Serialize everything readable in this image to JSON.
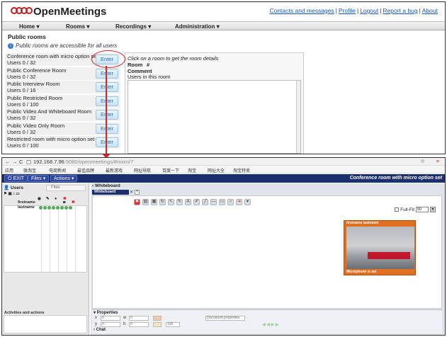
{
  "top": {
    "logo_text": "OpenMeetings",
    "links": [
      "Contacts and messages",
      "Profile",
      "Logout",
      "Report a bug",
      "About"
    ],
    "menu": [
      "Home",
      "Rooms",
      "Recordings",
      "Administration"
    ],
    "title": "Public rooms",
    "info": "Public rooms are accessible for all users",
    "rooms": [
      {
        "name": "Conference room with micro option set",
        "users": "Users 0 / 32"
      },
      {
        "name": "Public Conference Room",
        "users": "Users 0 / 32"
      },
      {
        "name": "Public Interview Room",
        "users": "Users 0 / 16"
      },
      {
        "name": "Public Restricted Room",
        "users": "Users 0 / 100"
      },
      {
        "name": "Public Video And Whiteboard Room",
        "users": "Users 0 / 32"
      },
      {
        "name": "Public Video Only Room",
        "users": "Users 0 / 32"
      },
      {
        "name": "Restricted room with micro option set",
        "users": "Users 0 / 100"
      }
    ],
    "enter_label": "Enter",
    "details": {
      "hint": "Click on a room to get the room details",
      "room_label": "Room",
      "room_value": "#",
      "comment_label": "Comment",
      "users_label": "Users in this room"
    }
  },
  "browser": {
    "url_host": "192.168.7.96",
    "url_rest": ":5080/openmeetings/#room/7",
    "bookmarks": [
      "应用",
      "微淘宝",
      "电商新闻",
      "最佳品牌",
      "最新游戏",
      "网址导航",
      "百度一下",
      "淘宝",
      "网址大全",
      "淘宝特卖"
    ]
  },
  "app": {
    "exit_label": "EXIT",
    "files_label": "Files",
    "actions_label": "Actions",
    "room_title": "Conference room with micro option set",
    "users_tab": "Users",
    "files_tab": "Files",
    "user_rows": [
      "firstname",
      "lastname"
    ],
    "activities_label": "Activities and actions",
    "whiteboard_title": "Whiteboard",
    "whiteboard_tab": "Whiteboard",
    "fullfit_label": "Full-Fit",
    "zoom_value": "50",
    "video_title": "firstname lastname",
    "video_footer": "Microphone is set",
    "properties_label": "Properties",
    "props": {
      "x": "0",
      "w": "0",
      "y": "0",
      "h": "0",
      "opacity": "100",
      "doc_props": "Document properties"
    },
    "chat_label": "Chat"
  },
  "colors": {
    "appbar": "#1b2f6e",
    "accent_link": "#1a56b8",
    "callout": "#e02020",
    "video_frame": "#e07020"
  }
}
